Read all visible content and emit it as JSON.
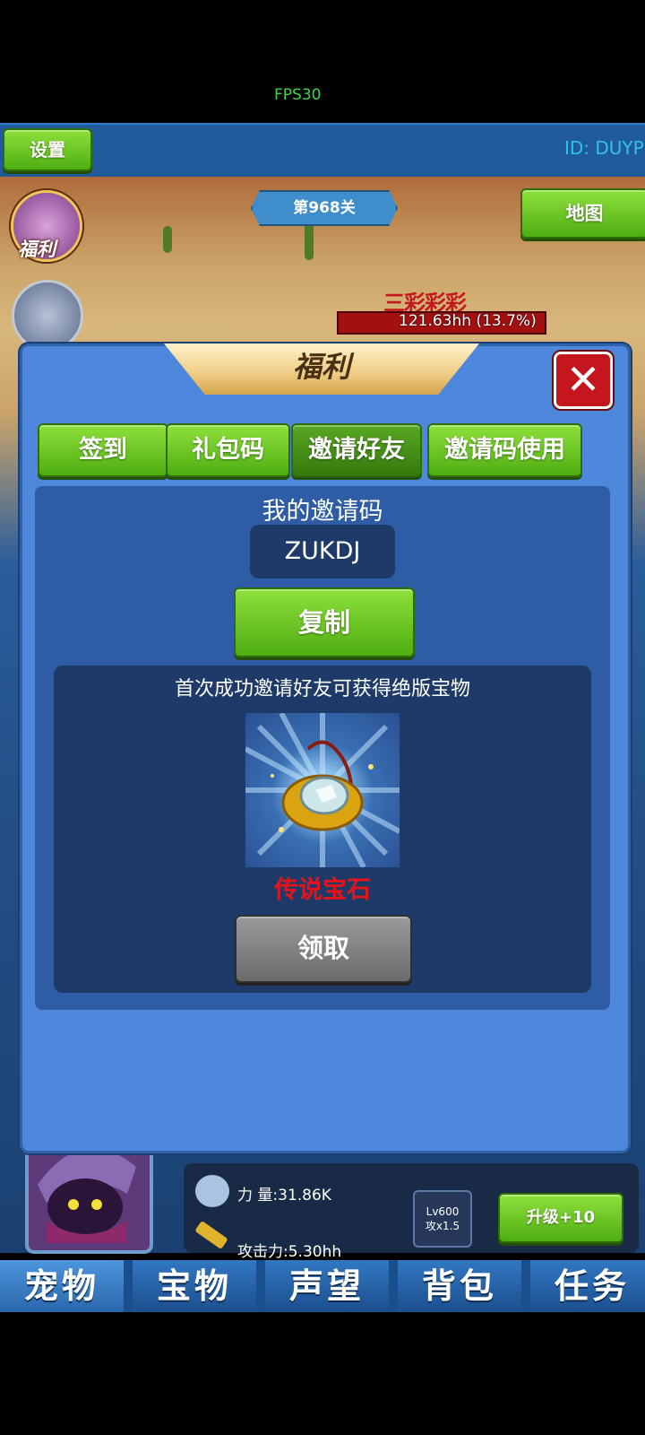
{
  "hud": {
    "fps": "FPS30",
    "settings_label": "设置",
    "player_id": "ID: DUYP",
    "level": "第968关",
    "map_label": "地图",
    "welfare_label": "福利",
    "enemy_hp": "121.63hh (13.7%)"
  },
  "modal": {
    "title": "福利",
    "tabs": [
      {
        "label": "签到"
      },
      {
        "label": "礼包码"
      },
      {
        "label": "邀请好友",
        "active": true
      },
      {
        "label": "邀请码使用"
      }
    ],
    "invite": {
      "heading": "我的邀请码",
      "code": "ZUKDJ",
      "copy_label": "复制"
    },
    "reward": {
      "description": "首次成功邀请好友可获得绝版宝物",
      "item_name": "传说宝石",
      "item_icon": "legend-gem-icon",
      "claim_label": "领取"
    }
  },
  "pet": {
    "power": "力  量:31.86K",
    "attack": "攻击力:5.30hh",
    "level_badge": "Lv600",
    "attack_mult": "攻x1.5",
    "upgrade_label": "升级+10"
  },
  "bottom_nav": [
    {
      "label": "宠物",
      "active": true
    },
    {
      "label": "宝物"
    },
    {
      "label": "声望"
    },
    {
      "label": "背包"
    },
    {
      "label": "任务"
    }
  ],
  "colors": {
    "accent_green": "#6cc424",
    "modal_blue": "#4e87db",
    "reward_red": "#e3151b"
  }
}
